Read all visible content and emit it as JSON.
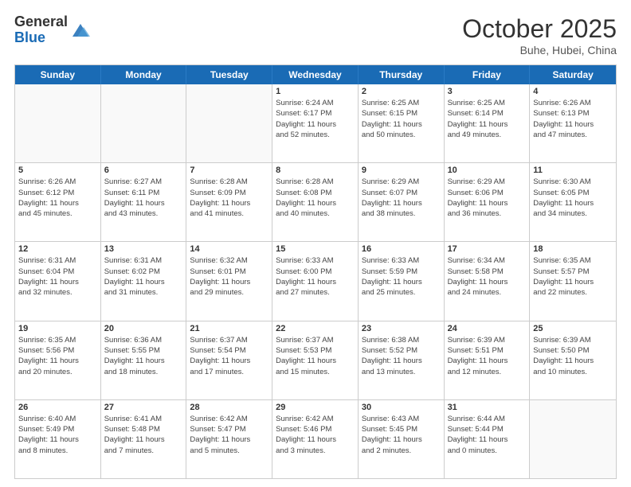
{
  "header": {
    "logo_general": "General",
    "logo_blue": "Blue",
    "month": "October 2025",
    "location": "Buhe, Hubei, China"
  },
  "day_headers": [
    "Sunday",
    "Monday",
    "Tuesday",
    "Wednesday",
    "Thursday",
    "Friday",
    "Saturday"
  ],
  "weeks": [
    [
      {
        "num": "",
        "info": ""
      },
      {
        "num": "",
        "info": ""
      },
      {
        "num": "",
        "info": ""
      },
      {
        "num": "1",
        "info": "Sunrise: 6:24 AM\nSunset: 6:17 PM\nDaylight: 11 hours\nand 52 minutes."
      },
      {
        "num": "2",
        "info": "Sunrise: 6:25 AM\nSunset: 6:15 PM\nDaylight: 11 hours\nand 50 minutes."
      },
      {
        "num": "3",
        "info": "Sunrise: 6:25 AM\nSunset: 6:14 PM\nDaylight: 11 hours\nand 49 minutes."
      },
      {
        "num": "4",
        "info": "Sunrise: 6:26 AM\nSunset: 6:13 PM\nDaylight: 11 hours\nand 47 minutes."
      }
    ],
    [
      {
        "num": "5",
        "info": "Sunrise: 6:26 AM\nSunset: 6:12 PM\nDaylight: 11 hours\nand 45 minutes."
      },
      {
        "num": "6",
        "info": "Sunrise: 6:27 AM\nSunset: 6:11 PM\nDaylight: 11 hours\nand 43 minutes."
      },
      {
        "num": "7",
        "info": "Sunrise: 6:28 AM\nSunset: 6:09 PM\nDaylight: 11 hours\nand 41 minutes."
      },
      {
        "num": "8",
        "info": "Sunrise: 6:28 AM\nSunset: 6:08 PM\nDaylight: 11 hours\nand 40 minutes."
      },
      {
        "num": "9",
        "info": "Sunrise: 6:29 AM\nSunset: 6:07 PM\nDaylight: 11 hours\nand 38 minutes."
      },
      {
        "num": "10",
        "info": "Sunrise: 6:29 AM\nSunset: 6:06 PM\nDaylight: 11 hours\nand 36 minutes."
      },
      {
        "num": "11",
        "info": "Sunrise: 6:30 AM\nSunset: 6:05 PM\nDaylight: 11 hours\nand 34 minutes."
      }
    ],
    [
      {
        "num": "12",
        "info": "Sunrise: 6:31 AM\nSunset: 6:04 PM\nDaylight: 11 hours\nand 32 minutes."
      },
      {
        "num": "13",
        "info": "Sunrise: 6:31 AM\nSunset: 6:02 PM\nDaylight: 11 hours\nand 31 minutes."
      },
      {
        "num": "14",
        "info": "Sunrise: 6:32 AM\nSunset: 6:01 PM\nDaylight: 11 hours\nand 29 minutes."
      },
      {
        "num": "15",
        "info": "Sunrise: 6:33 AM\nSunset: 6:00 PM\nDaylight: 11 hours\nand 27 minutes."
      },
      {
        "num": "16",
        "info": "Sunrise: 6:33 AM\nSunset: 5:59 PM\nDaylight: 11 hours\nand 25 minutes."
      },
      {
        "num": "17",
        "info": "Sunrise: 6:34 AM\nSunset: 5:58 PM\nDaylight: 11 hours\nand 24 minutes."
      },
      {
        "num": "18",
        "info": "Sunrise: 6:35 AM\nSunset: 5:57 PM\nDaylight: 11 hours\nand 22 minutes."
      }
    ],
    [
      {
        "num": "19",
        "info": "Sunrise: 6:35 AM\nSunset: 5:56 PM\nDaylight: 11 hours\nand 20 minutes."
      },
      {
        "num": "20",
        "info": "Sunrise: 6:36 AM\nSunset: 5:55 PM\nDaylight: 11 hours\nand 18 minutes."
      },
      {
        "num": "21",
        "info": "Sunrise: 6:37 AM\nSunset: 5:54 PM\nDaylight: 11 hours\nand 17 minutes."
      },
      {
        "num": "22",
        "info": "Sunrise: 6:37 AM\nSunset: 5:53 PM\nDaylight: 11 hours\nand 15 minutes."
      },
      {
        "num": "23",
        "info": "Sunrise: 6:38 AM\nSunset: 5:52 PM\nDaylight: 11 hours\nand 13 minutes."
      },
      {
        "num": "24",
        "info": "Sunrise: 6:39 AM\nSunset: 5:51 PM\nDaylight: 11 hours\nand 12 minutes."
      },
      {
        "num": "25",
        "info": "Sunrise: 6:39 AM\nSunset: 5:50 PM\nDaylight: 11 hours\nand 10 minutes."
      }
    ],
    [
      {
        "num": "26",
        "info": "Sunrise: 6:40 AM\nSunset: 5:49 PM\nDaylight: 11 hours\nand 8 minutes."
      },
      {
        "num": "27",
        "info": "Sunrise: 6:41 AM\nSunset: 5:48 PM\nDaylight: 11 hours\nand 7 minutes."
      },
      {
        "num": "28",
        "info": "Sunrise: 6:42 AM\nSunset: 5:47 PM\nDaylight: 11 hours\nand 5 minutes."
      },
      {
        "num": "29",
        "info": "Sunrise: 6:42 AM\nSunset: 5:46 PM\nDaylight: 11 hours\nand 3 minutes."
      },
      {
        "num": "30",
        "info": "Sunrise: 6:43 AM\nSunset: 5:45 PM\nDaylight: 11 hours\nand 2 minutes."
      },
      {
        "num": "31",
        "info": "Sunrise: 6:44 AM\nSunset: 5:44 PM\nDaylight: 11 hours\nand 0 minutes."
      },
      {
        "num": "",
        "info": ""
      }
    ]
  ]
}
